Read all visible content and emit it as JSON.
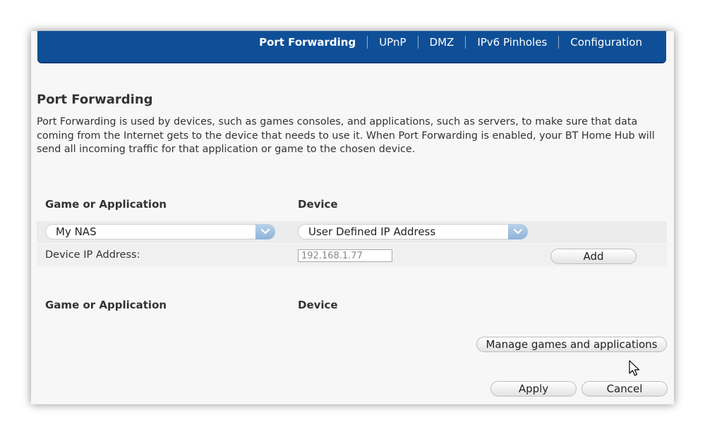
{
  "nav": {
    "tabs": [
      {
        "label": "Port Forwarding",
        "active": true
      },
      {
        "label": "UPnP",
        "active": false
      },
      {
        "label": "DMZ",
        "active": false
      },
      {
        "label": "IPv6 Pinholes",
        "active": false
      },
      {
        "label": "Configuration",
        "active": false
      }
    ]
  },
  "page": {
    "title": "Port Forwarding",
    "description": "Port Forwarding is used by devices, such as games consoles, and applications, such as servers, to make sure that data coming from the Internet gets to the device that needs to use it. When Port Forwarding is enabled, your BT Home Hub will send all incoming traffic for that application or game to the chosen device."
  },
  "add_rule": {
    "headers": {
      "game": "Game or Application",
      "device": "Device"
    },
    "game_select": {
      "value": "My NAS"
    },
    "device_select": {
      "value": "User Defined IP Address"
    },
    "ip_label": "Device IP Address:",
    "ip_value": "192.168.1.77",
    "add_label": "Add"
  },
  "rules": {
    "headers": {
      "game": "Game or Application",
      "device": "Device"
    }
  },
  "buttons": {
    "manage": "Manage games and applications",
    "apply": "Apply",
    "cancel": "Cancel"
  },
  "colors": {
    "nav_bg": "#0f4f97",
    "panel_bg": "#f7f7f7",
    "row_band": "#ececec"
  },
  "icons": {
    "select_chevron": "chevron-down-icon",
    "cursor": "mouse-pointer-icon"
  }
}
